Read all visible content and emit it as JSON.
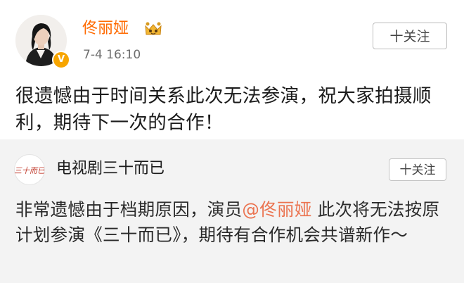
{
  "post": {
    "author": "佟丽娅",
    "timestamp": "7-4 16:10",
    "follow_label": "十关注",
    "text": "很遗憾由于时间关系此次无法参演，祝大家拍摄顺利，期待下一次的合作！",
    "verified_badge": "V",
    "crown_icon": "crown-icon",
    "accent_color": "#ff6a00"
  },
  "repost": {
    "author": "电视剧三十而已",
    "follow_label": "十关注",
    "avatar_text": "三十而已",
    "text_before": "非常遗憾由于档期原因，演员",
    "mention": "@佟丽娅",
    "text_after": " 此次将无法按原计划参演《三十而已》，期待有合作机会共谱新作～",
    "mention_color": "#eb7350"
  }
}
